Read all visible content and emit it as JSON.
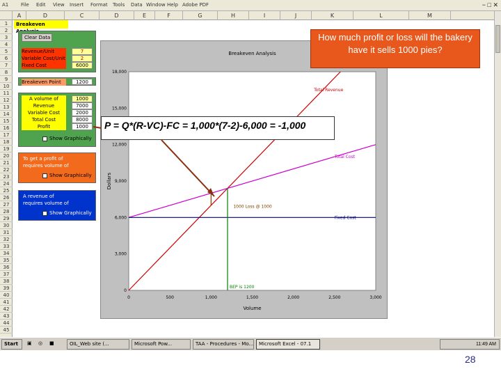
{
  "excel": {
    "name_box": "A1",
    "tab_cells": [
      "A",
      "D",
      "C",
      "D",
      "E",
      "F",
      "G",
      "H",
      "I",
      "J",
      "K",
      "L",
      "M"
    ],
    "menu": [
      "File",
      "Edit",
      "View",
      "Insert",
      "Format",
      "Tools",
      "Data",
      "Window",
      "Help",
      "Adobe PDF"
    ],
    "row_numbers": [
      "1",
      "2",
      "3",
      "4",
      "5",
      "6",
      "7",
      "8",
      "9",
      "10",
      "11",
      "12",
      "13",
      "14",
      "15",
      "16",
      "17",
      "18",
      "19",
      "20",
      "21",
      "22",
      "23",
      "24",
      "25",
      "26",
      "27",
      "28",
      "29",
      "30",
      "31",
      "32",
      "33",
      "34",
      "35",
      "36",
      "37",
      "38",
      "39",
      "40",
      "41",
      "42",
      "43",
      "44",
      "45"
    ]
  },
  "left_panel": {
    "header_label": "Breakeven Analysis",
    "clear_button": "Clear Data",
    "inputs": [
      {
        "label": "Revenue/Unit",
        "value": "7"
      },
      {
        "label": "Variable Cost/Unit",
        "value": "2"
      },
      {
        "label": "Fixed Cost",
        "value": "6000"
      }
    ],
    "breakeven_label": "Breakeven Point",
    "breakeven_value": "1200",
    "volume_rows": [
      {
        "label": "A volume of",
        "value": "1000"
      },
      {
        "label": "Revenue",
        "value": "7000"
      },
      {
        "label": "Variable Cost",
        "value": "2000"
      },
      {
        "label": "Total Cost",
        "value": "8000"
      },
      {
        "label": "Profit",
        "value": "1000"
      }
    ],
    "volume_check": "Show Graphically",
    "profit_box_lines": [
      "To get a profit of",
      "requires volume of"
    ],
    "profit_check": "Show Graphically",
    "revenue_box_lines": [
      "A revenue of",
      "requires volume of"
    ],
    "revenue_check": "Show Graphically"
  },
  "chart_data": {
    "type": "line",
    "title": "Breakeven Analysis",
    "xlabel": "Volume",
    "ylabel": "Dollars",
    "xlim": [
      0,
      3000
    ],
    "ylim": [
      0,
      18000
    ],
    "x_ticks": [
      "0",
      "500",
      "1,000",
      "1,500",
      "2,000",
      "2,500",
      "3,000"
    ],
    "y_ticks": [
      "0",
      "3,000",
      "6,000",
      "9,000",
      "12,000",
      "15,000",
      "18,000"
    ],
    "series": [
      {
        "name": "Total Revenue",
        "x": [
          0,
          3000
        ],
        "y": [
          0,
          21000
        ],
        "color": "#cc0000"
      },
      {
        "name": "Total Cost",
        "x": [
          0,
          3000
        ],
        "y": [
          6000,
          12000
        ],
        "color": "#cc00cc"
      },
      {
        "name": "Fixed Cost",
        "x": [
          0,
          3000
        ],
        "y": [
          6000,
          6000
        ],
        "color": "#000080"
      }
    ],
    "breakeven": {
      "x": 1200,
      "label": "BEP is 1200",
      "color": "#008000"
    },
    "loss_marker": {
      "x": 1000,
      "y_low": 7000,
      "y_high": 8000,
      "label": "1000 Loss @ 1000"
    }
  },
  "callouts": {
    "question": "How much profit or loss will the bakery have it sells 1000 pies?",
    "answer": "P = Q*(R-VC)-FC = 1,000*(7-2)-6,000 = -1,000"
  },
  "taskbar": {
    "start": "Start",
    "items": [
      "OIL_Web site (...",
      "Microsoft Pow...",
      "TAA - Procedures - Mo...",
      "Microsoft Excel - 07.1"
    ],
    "clock": "11:49 AM"
  },
  "slide_number": "28",
  "colors": {
    "callout_orange": "#e8581c",
    "panel_orange": "#f26b1d",
    "panel_blue": "#0033cc",
    "header_yellow": "#ffff00",
    "panel_green": "#4fa34f"
  }
}
